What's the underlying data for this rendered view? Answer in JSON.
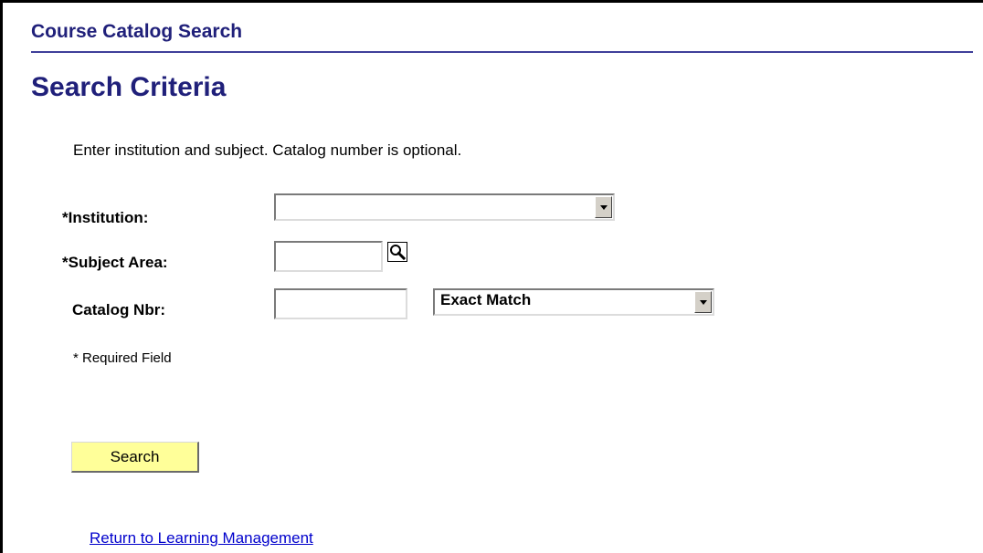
{
  "header": {
    "title": "Course Catalog Search"
  },
  "section": {
    "title": "Search Criteria",
    "instructions": "Enter institution and subject.  Catalog number is optional."
  },
  "form": {
    "institution": {
      "label": "*Institution:",
      "value": ""
    },
    "subject_area": {
      "label": "*Subject Area:",
      "value": "",
      "lookup_icon": "search-icon"
    },
    "catalog_nbr": {
      "label": "Catalog Nbr:",
      "value": "",
      "match_type": "Exact Match"
    },
    "required_note": "* Required Field"
  },
  "actions": {
    "search_label": "Search",
    "return_link": "Return to Learning Management"
  },
  "colors": {
    "title": "#20207a",
    "rule": "#3f3f9a",
    "button_bg": "#ffff99",
    "link": "#0000cc"
  }
}
